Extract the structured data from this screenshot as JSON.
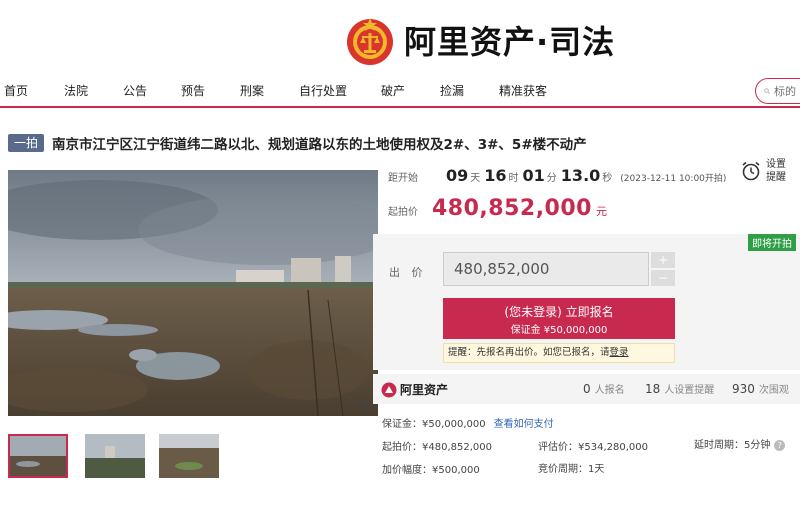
{
  "brand": {
    "name": "阿里资产·司法"
  },
  "nav": {
    "items": [
      "首页",
      "法院",
      "公告",
      "预告",
      "刑案",
      "自行处置",
      "破产",
      "捡漏",
      "精准获客"
    ],
    "search_placeholder": "标的"
  },
  "listing": {
    "tag": "一拍",
    "title": "南京市江宁区江宁街道纬二路以北、规划道路以东的土地使用权及2#、3#、5#楼不动产"
  },
  "countdown": {
    "label": "距开始",
    "days": "09",
    "days_unit": "天",
    "hours": "16",
    "hours_unit": "时",
    "minutes": "01",
    "minutes_unit": "分",
    "seconds": "13.0",
    "seconds_unit": "秒",
    "start_note": "(2023-12-11 10:00开拍)"
  },
  "reminder": {
    "line1": "设置",
    "line2": "提醒"
  },
  "start_price": {
    "label": "起拍价",
    "value": "480,852,000",
    "unit": "元"
  },
  "bid": {
    "badge": "即将开拍",
    "label": "出 价",
    "value": "480,852,000",
    "plus": "+",
    "minus": "−",
    "button_main": "(您未登录) 立即报名",
    "button_sub": "保证金 ¥50,000,000",
    "tip_text": "提醒：先报名再出价。如您已报名，请",
    "tip_link": "登录"
  },
  "stats": {
    "logo_text": "阿里资产",
    "signups": "0",
    "signups_label": "人报名",
    "reminders": "18",
    "reminders_label": "人设置提醒",
    "views": "930",
    "views_label": "次围观"
  },
  "details": {
    "deposit": "保证金：¥50,000,000",
    "deposit_link": "查看如何支付",
    "start": "起拍价：¥480,852,000",
    "appraisal": "评估价：¥534,280,000",
    "delay": "延时周期：5分钟",
    "increment": "加价幅度：¥500,000",
    "cycle": "竞价周期：1天"
  },
  "colors": {
    "accent": "#c8294e",
    "badge_green": "#2f9e47",
    "link": "#3565b5"
  }
}
